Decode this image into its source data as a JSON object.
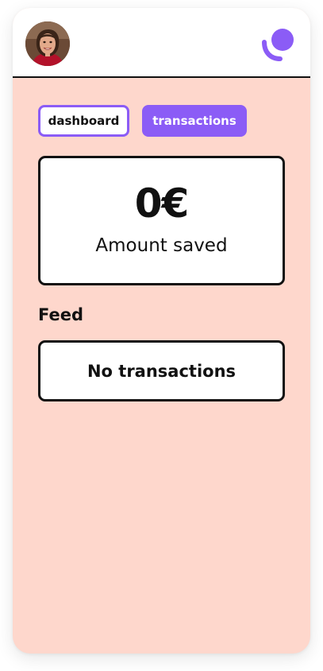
{
  "header": {
    "avatar_icon": "user-avatar-photo",
    "logo_icon": "brand-logo-icon",
    "accent_color": "#8b5cf6"
  },
  "tabs": [
    {
      "label": "dashboard",
      "selected": true
    },
    {
      "label": "transactions",
      "selected": false
    }
  ],
  "summary": {
    "amount": "0€",
    "label": "Amount saved"
  },
  "feed": {
    "title": "Feed",
    "empty_text": "No transactions"
  },
  "colors": {
    "background": "#fed7cc",
    "accent": "#8b5cf6",
    "card_border": "#111111"
  }
}
